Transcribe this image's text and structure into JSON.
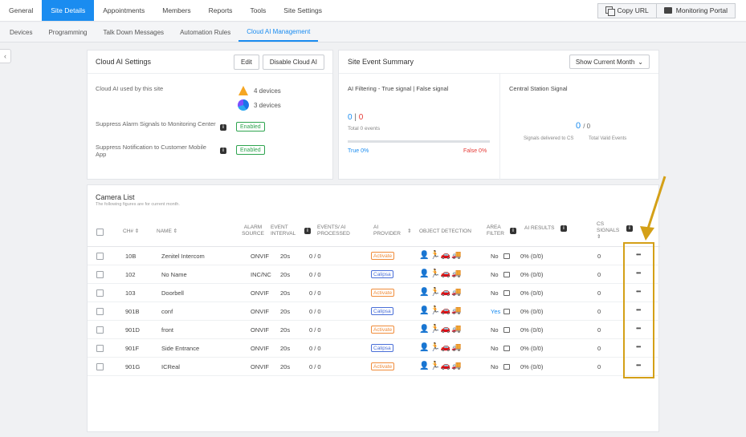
{
  "topnav": {
    "tabs": [
      "General",
      "Site Details",
      "Appointments",
      "Members",
      "Reports",
      "Tools",
      "Site Settings"
    ],
    "active": "Site Details",
    "copy_url": "Copy URL",
    "monitoring_portal": "Monitoring Portal"
  },
  "subnav": {
    "tabs": [
      "Devices",
      "Programming",
      "Talk Down Messages",
      "Automation Rules",
      "Cloud AI Management"
    ],
    "active": "Cloud AI Management"
  },
  "cloud_settings": {
    "title": "Cloud AI Settings",
    "edit": "Edit",
    "disable": "Disable Cloud AI",
    "used_label": "Cloud AI used by this site",
    "provider_a_devices": "4 devices",
    "provider_b_devices": "3 devices",
    "suppress_alarm_label": "Suppress Alarm Signals to Monitoring Center",
    "suppress_alarm_status": "Enabled",
    "suppress_notif_label": "Suppress Notification to Customer Mobile App",
    "suppress_notif_status": "Enabled"
  },
  "summary": {
    "title": "Site Event Summary",
    "period": "Show Current Month",
    "ai_filter_title": "AI Filtering - True signal | False signal",
    "true_count": "0",
    "sep": "|",
    "false_count": "0",
    "total_events": "Total 0 events",
    "true_pct": "True 0%",
    "false_pct": "False 0%",
    "cs_title": "Central Station Signal",
    "cs_count": "0",
    "cs_total": "/ 0",
    "cs_delivered": "Signals delivered to CS",
    "cs_valid": "Total Valid Events"
  },
  "camera_list": {
    "title": "Camera List",
    "subtitle": "The following figures are for current month.",
    "headers": {
      "ch": "CH# ⇕",
      "name": "NAME ⇕",
      "alarm_source": "ALARM SOURCE",
      "event_interval": "EVENT INTERVAL",
      "events": "EVENTS/ AI PROCESSED",
      "ai_provider": "AI PROVIDER",
      "object_detection": "OBJECT DETECTION",
      "area_filter": "AREA FILTER",
      "ai_results": "AI RESULTS",
      "cs_signals": "CS SIGNALS ⇕"
    },
    "rows": [
      {
        "ch": "10B",
        "name": "Zenitel Intercom",
        "source": "ONVIF",
        "interval": "20s",
        "events": "0 / 0",
        "provider": "Activate",
        "objects": "👤🏃🚗🚚",
        "area": "No",
        "results": "0% (0/0)",
        "cs": "0",
        "more": "•••"
      },
      {
        "ch": "102",
        "name": "No Name",
        "source": "INC/NC",
        "interval": "20s",
        "events": "0 / 0",
        "provider": "Calipsa",
        "objects": "👤🏃🚗🚚",
        "area": "No",
        "results": "0% (0/0)",
        "cs": "0",
        "more": "•••"
      },
      {
        "ch": "103",
        "name": "Doorbell",
        "source": "ONVIF",
        "interval": "20s",
        "events": "0 / 0",
        "provider": "Activate",
        "objects": "👤🏃🚗🚚",
        "area": "No",
        "results": "0% (0/0)",
        "cs": "0",
        "more": "•••"
      },
      {
        "ch": "901B",
        "name": "conf",
        "source": "ONVIF",
        "interval": "20s",
        "events": "0 / 0",
        "provider": "Calipsa",
        "objects": "👤🏃🚗🚚",
        "area": "Yes",
        "results": "0% (0/0)",
        "cs": "0",
        "more": "•••"
      },
      {
        "ch": "901D",
        "name": "front",
        "source": "ONVIF",
        "interval": "20s",
        "events": "0 / 0",
        "provider": "Activate",
        "objects": "👤🏃🚗🚚",
        "area": "No",
        "results": "0% (0/0)",
        "cs": "0",
        "more": "•••"
      },
      {
        "ch": "901F",
        "name": "Side Entrance",
        "source": "ONVIF",
        "interval": "20s",
        "events": "0 / 0",
        "provider": "Calipsa",
        "objects": "👤🏃🚗🚚",
        "area": "No",
        "results": "0% (0/0)",
        "cs": "0",
        "more": "•••"
      },
      {
        "ch": "901G",
        "name": "ICReal",
        "source": "ONVIF",
        "interval": "20s",
        "events": "0 / 0",
        "provider": "Activate",
        "objects": "👤🏃🚗🚚",
        "area": "No",
        "results": "0% (0/0)",
        "cs": "0",
        "more": "•••"
      }
    ]
  },
  "colors": {
    "accent": "#1a8cf0",
    "enabled": "#2ea44f",
    "activate": "#f08c3a",
    "calipsa": "#4a6fd8",
    "highlight": "#d4a017"
  }
}
